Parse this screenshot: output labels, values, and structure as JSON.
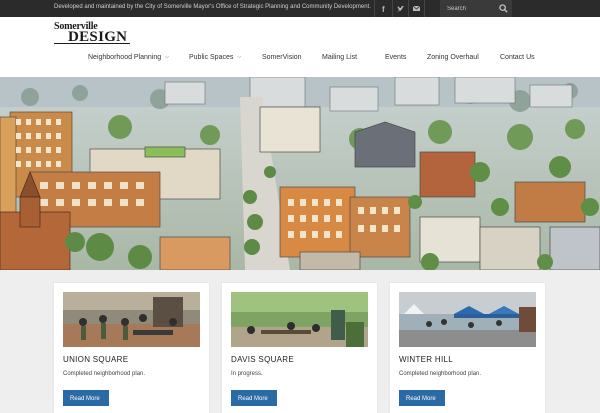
{
  "topbar": {
    "tagline": "Developed and maintained by the City of Somerville Mayor's Office of Strategic Planning and Community Development.",
    "social_icons": [
      "facebook-icon",
      "twitter-icon",
      "email-icon"
    ],
    "search_placeholder": "Search"
  },
  "logo": {
    "line1": "Somerville",
    "line2": "DESIGN"
  },
  "nav": {
    "items": [
      {
        "label": "Neighborhood Planning",
        "dropdown": true
      },
      {
        "label": "Public Spaces",
        "dropdown": true
      },
      {
        "label": "SomerVision",
        "dropdown": false
      },
      {
        "label": "Mailing List",
        "dropdown": false
      },
      {
        "label": "Events",
        "dropdown": false
      },
      {
        "label": "Zoning Overhaul",
        "dropdown": false
      },
      {
        "label": "Contact Us",
        "dropdown": false
      }
    ]
  },
  "cards": [
    {
      "title": "UNION SQUARE",
      "desc": "Completed neighborhood plan.",
      "button": "Read More"
    },
    {
      "title": "DAVIS SQUARE",
      "desc": "In progress.",
      "button": "Read More"
    },
    {
      "title": "WINTER HILL",
      "desc": "Completed neighborhood plan.",
      "button": "Read More"
    }
  ],
  "colors": {
    "topbar_bg": "#2b2b2b",
    "button_blue": "#2a6aa5",
    "page_bg": "#eeeeee"
  }
}
